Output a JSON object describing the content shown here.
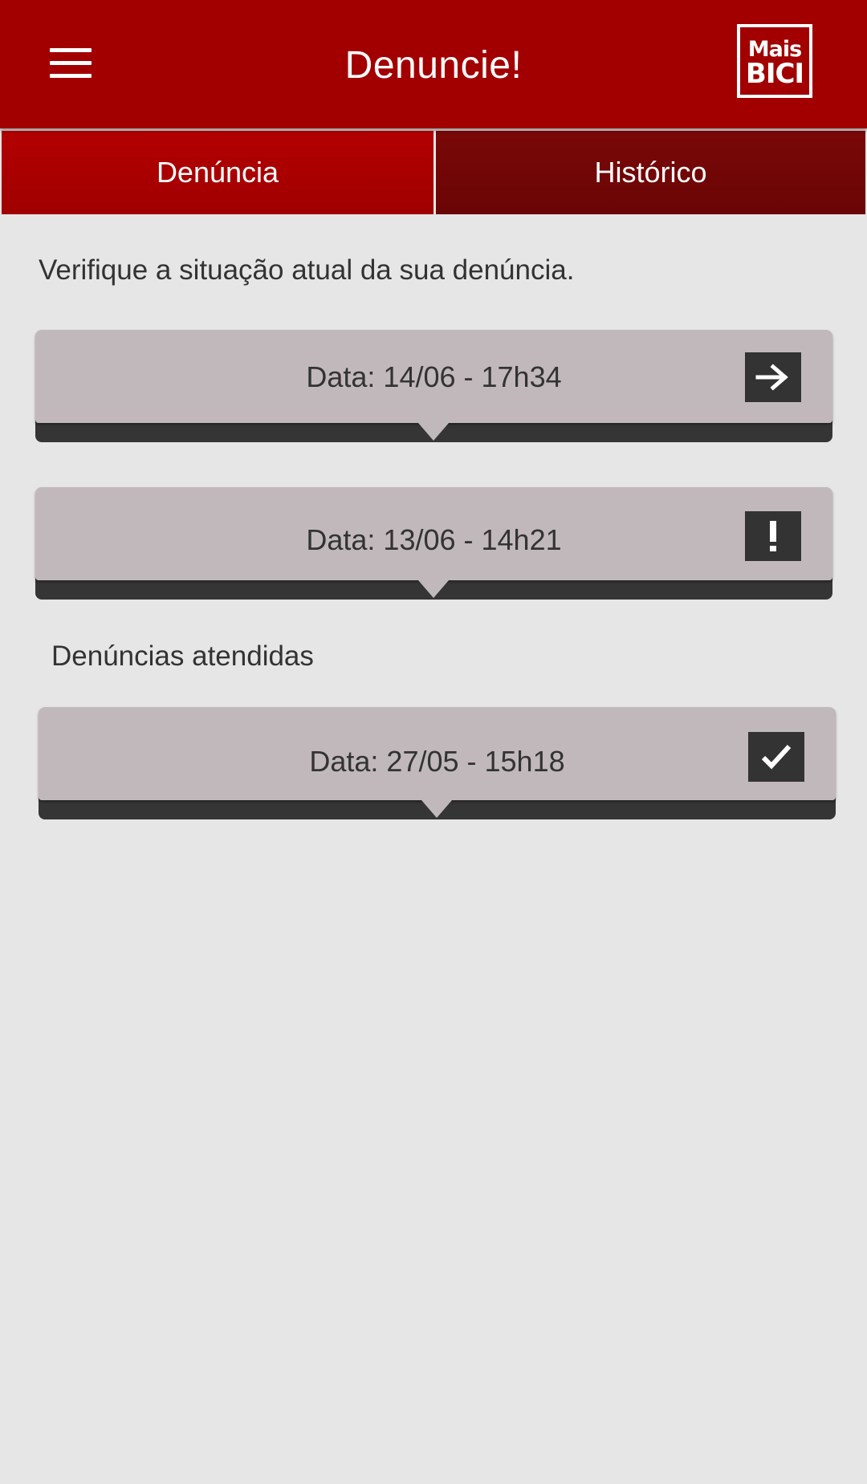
{
  "app_bar": {
    "title": "Denuncie!",
    "logo_line1": "Mais",
    "logo_line2": "BICI",
    "menu_icon": "hamburger-menu-icon"
  },
  "tabs": [
    {
      "label": "Denúncia",
      "active": true
    },
    {
      "label": "Histórico",
      "active": false
    }
  ],
  "intro_text": "Verifique a situação atual da sua denúncia.",
  "pending": [
    {
      "label": "Data: 14/06 - 17h34",
      "status_icon": "arrow-right-icon"
    },
    {
      "label": "Data: 13/06 - 14h21",
      "status_icon": "exclamation-icon"
    }
  ],
  "resolved_title": "Denúncias atendidas",
  "resolved": [
    {
      "label": "Data: 27/05 - 15h18",
      "status_icon": "checkmark-icon"
    }
  ],
  "colors": {
    "app_bar": "#a20000",
    "tab_active": "#a00000",
    "tab_inactive": "#6f0606",
    "card_face": "#c1b8bc",
    "card_base": "#353535",
    "background": "#e6e6e6"
  }
}
